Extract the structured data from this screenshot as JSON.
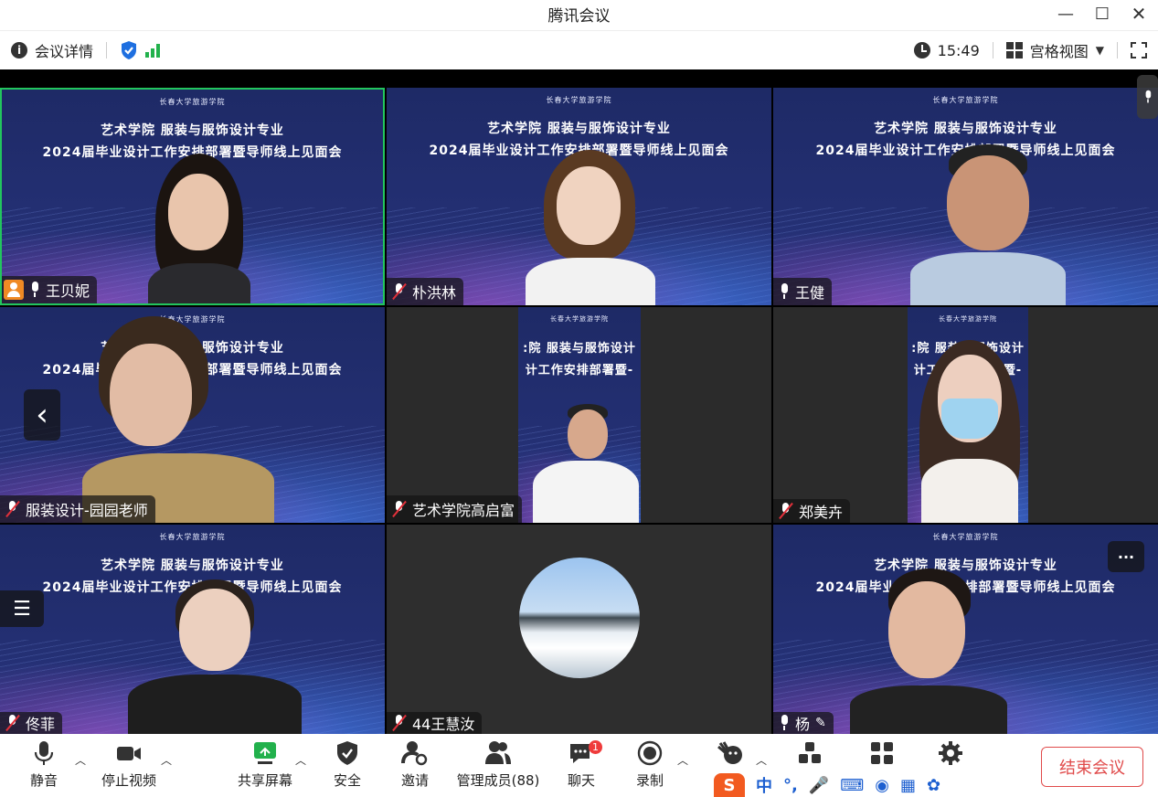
{
  "window": {
    "title": "腾讯会议"
  },
  "topbar": {
    "meeting_details": "会议详情",
    "time": "15:49",
    "view_mode": "宫格视图"
  },
  "banner": {
    "logo_text": "长春大学旅游学院",
    "line1": "艺术学院 服装与服饰设计专业",
    "line2": "2024届毕业设计工作安排部署暨导师线上见面会",
    "line1_cropped": ":院 服装与服饰设计",
    "line2_cropped": "计工作安排部署暨-"
  },
  "participants": [
    {
      "name": "王贝妮",
      "mic": "on",
      "host": true,
      "active_speaker": true
    },
    {
      "name": "朴洪林",
      "mic": "muted"
    },
    {
      "name": "王健",
      "mic": "on"
    },
    {
      "name": "服装设计-园园老师",
      "mic": "muted"
    },
    {
      "name": "艺术学院高启富",
      "mic": "muted"
    },
    {
      "name": "郑美卉",
      "mic": "muted"
    },
    {
      "name": "佟菲",
      "mic": "muted"
    },
    {
      "name": "44王慧汝",
      "mic": "muted"
    },
    {
      "name": "杨",
      "mic": "on"
    }
  ],
  "overlay": {
    "more_label": "···",
    "prev_page": "‹"
  },
  "toolbar": {
    "mute": "静音",
    "stop_video": "停止视频",
    "share_screen": "共享屏幕",
    "security": "安全",
    "invite": "邀请",
    "manage_members": "管理成员(88)",
    "chat": "聊天",
    "chat_badge": "1",
    "record": "录制",
    "end_meeting": "结束会议"
  },
  "ime": {
    "label": "中"
  },
  "colors": {
    "active_border": "#22c55e",
    "end_red": "#e04a4a",
    "banner_blue": "#232f72",
    "share_green": "#22b14c"
  }
}
